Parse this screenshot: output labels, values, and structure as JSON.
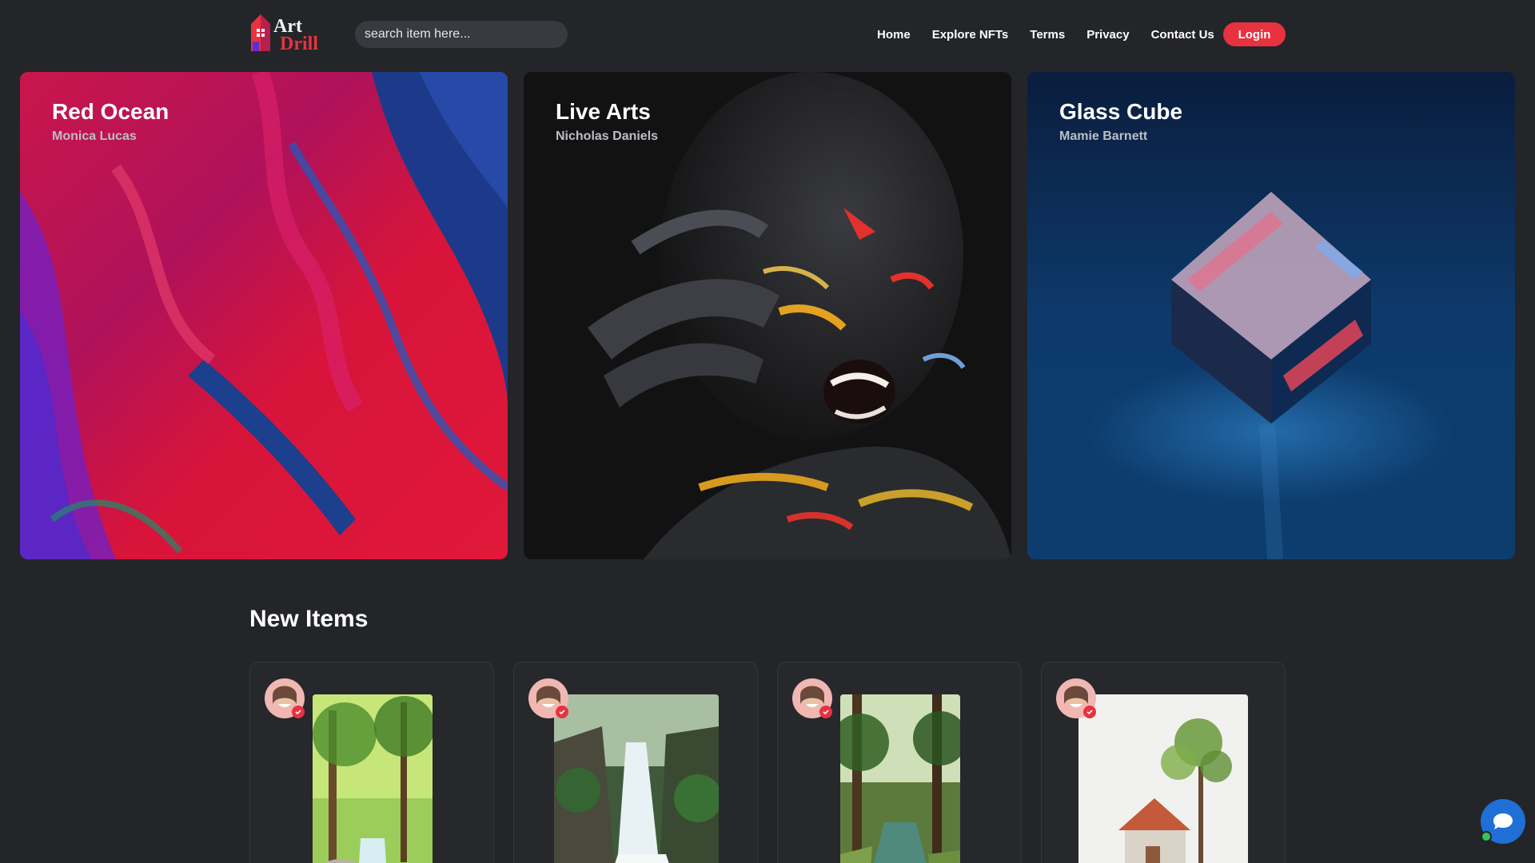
{
  "header": {
    "logo": {
      "line1": "Art",
      "line2": "Drill"
    },
    "search_placeholder": "search item here...",
    "nav": [
      "Home",
      "Explore NFTs",
      "Terms",
      "Privacy",
      "Contact Us"
    ],
    "login_label": "Login"
  },
  "featured": [
    {
      "title": "Red Ocean",
      "artist": "Monica Lucas"
    },
    {
      "title": "Live Arts",
      "artist": "Nicholas Daniels"
    },
    {
      "title": "Glass Cube",
      "artist": "Mamie Barnett"
    }
  ],
  "new_items": {
    "title": "New Items"
  },
  "colors": {
    "background": "#232529",
    "accent": "#e8323f",
    "chat": "#1f6fd6"
  }
}
